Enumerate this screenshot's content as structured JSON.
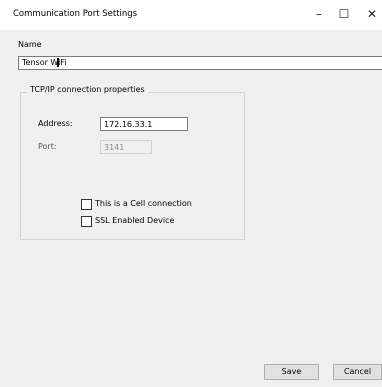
{
  "window": {
    "title": "Communication Port Settings"
  },
  "controls": {
    "minimize": "–",
    "maximize": "☐",
    "close": "✕"
  },
  "name_field": {
    "label": "Name",
    "value": "Tensor WiFi"
  },
  "tcpip_group": {
    "title": "TCP/IP connection properties",
    "address_label": "Address:",
    "address_value": "172.16.33.1",
    "port_label": "Port:",
    "port_value": "3141"
  },
  "options": {
    "cell_connection": {
      "label": "This is a Cell connection",
      "checked": false
    },
    "ssl_device": {
      "label": "SSL Enabled Device",
      "checked": false
    }
  },
  "buttons": {
    "save": "Save",
    "cancel": "Cancel"
  }
}
